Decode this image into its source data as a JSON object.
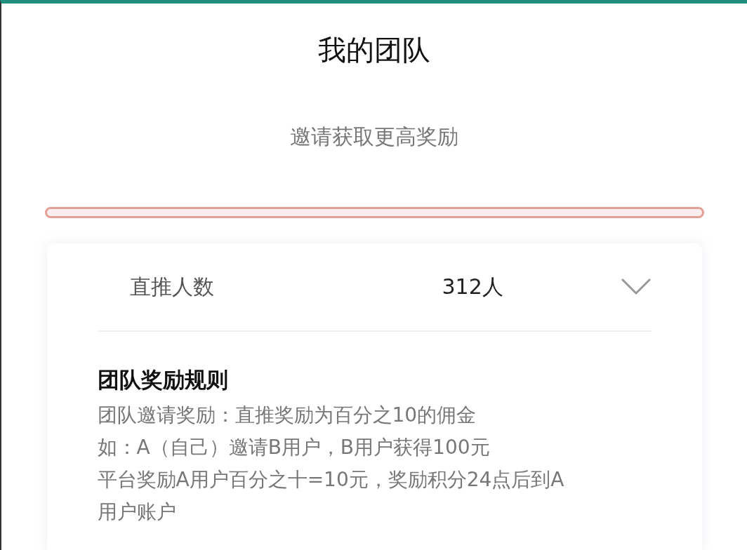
{
  "header": {
    "title": "我的团队",
    "subtitle": "邀请获取更高奖励"
  },
  "progress": {
    "level": 0
  },
  "team": {
    "label": "直推人数",
    "value": "312人",
    "expanded": false
  },
  "rules": {
    "title": "团队奖励规则",
    "lines": [
      "团队邀请奖励：直推奖励为百分之10的佣金",
      "如：A（自己）邀请B用户，B用户获得100元",
      "平台奖励A用户百分之十=10元，奖励积分24点后到A用户账户"
    ]
  }
}
